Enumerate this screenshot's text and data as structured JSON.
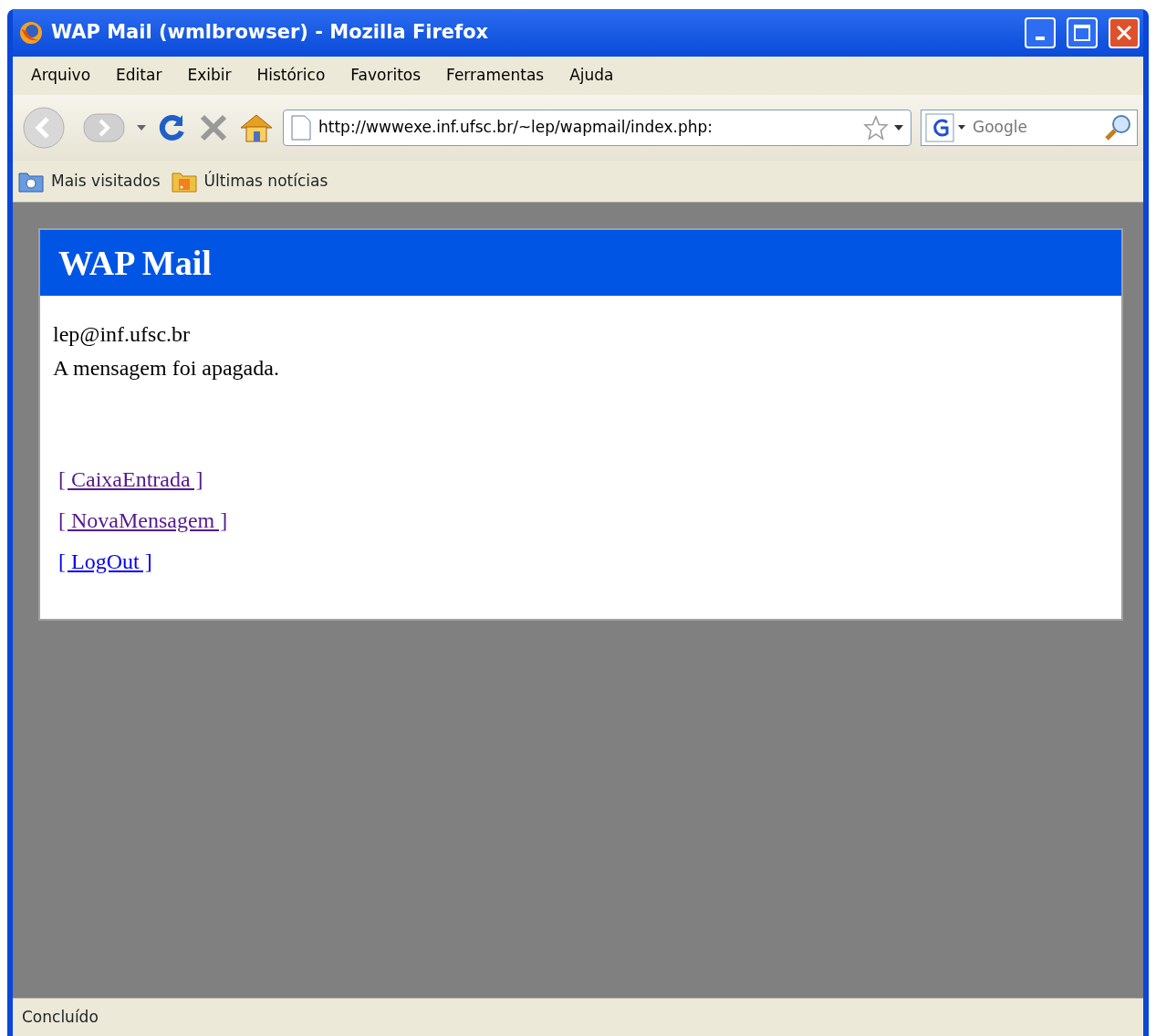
{
  "window": {
    "title": "WAP Mail (wmlbrowser) - Mozilla Firefox"
  },
  "menu": [
    "Arquivo",
    "Editar",
    "Exibir",
    "Histórico",
    "Favoritos",
    "Ferramentas",
    "Ajuda"
  ],
  "address": {
    "value": "http://wwwexe.inf.ufsc.br/~lep/wapmail/index.php:"
  },
  "search": {
    "placeholder": "Google"
  },
  "bookmarks": [
    {
      "label": "Mais visitados",
      "kind": "folder"
    },
    {
      "label": "Últimas notícias",
      "kind": "feed"
    }
  ],
  "page": {
    "header": "WAP Mail",
    "email": "lep@inf.ufsc.br",
    "message": "A mensagem foi apagada.",
    "links": [
      {
        "label": "[ CaixaEntrada ]",
        "visited": true
      },
      {
        "label": "[ NovaMensagem ]",
        "visited": true
      },
      {
        "label": "[ LogOut ]",
        "visited": false
      }
    ]
  },
  "status_bar": "Concluído"
}
